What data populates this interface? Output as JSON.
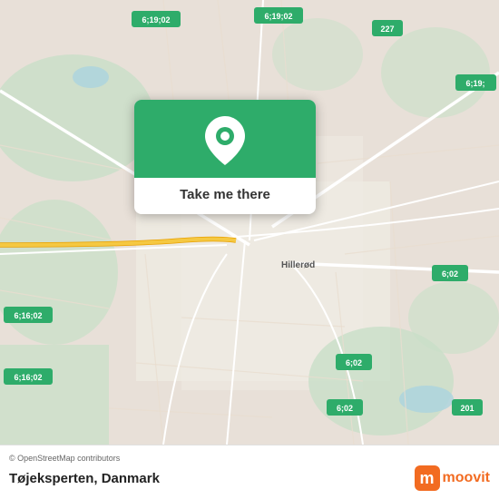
{
  "map": {
    "attribution": "© OpenStreetMap contributors",
    "city": "Hillerød",
    "country": "Danmark"
  },
  "card": {
    "button_label": "Take me there"
  },
  "footer": {
    "place_name": "Tøjeksperten",
    "country": "Danmark",
    "moovit_label": "moovit"
  },
  "route_badges": [
    "6;19;02",
    "6;19;02",
    "227",
    "6;19;",
    "6;16;02",
    "6;16;02",
    "6;02",
    "6;02",
    "6;02",
    "201"
  ],
  "colors": {
    "green": "#2eac6a",
    "orange": "#f26b21",
    "road_yellow": "#f5c842"
  }
}
